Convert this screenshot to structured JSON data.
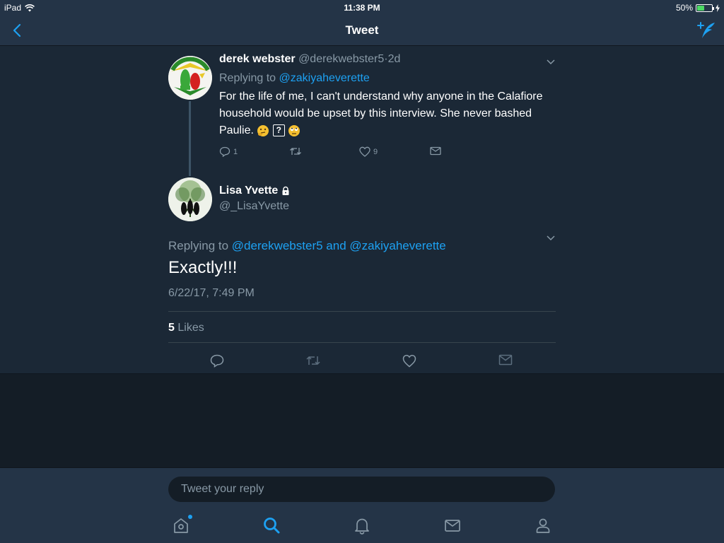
{
  "status_bar": {
    "device": "iPad",
    "time": "11:38 PM",
    "battery_percent": "50%",
    "battery_level": 0.5
  },
  "nav": {
    "title": "Tweet"
  },
  "reply_tweet": {
    "name": "derek webster",
    "handle": "@derekwebster5",
    "separator": "·",
    "age": "2d",
    "replying_prefix": "Replying to",
    "replying_to": "@zakiyaheverette",
    "text": "For the life of me, I can't understand why anyone in the Calafiore household would be upset by this interview. She never bashed Paulie.",
    "emoji_box": "?",
    "reply_count": "1",
    "like_count": "9"
  },
  "main_tweet": {
    "name": "Lisa Yvette",
    "handle": "@_LisaYvette",
    "replying_prefix": "Replying to",
    "replying_to_1": "@derekwebster5",
    "replying_and": "and",
    "replying_to_2": "@zakiyaheverette",
    "text": "Exactly!!!",
    "date": "6/22/17, 7:49 PM",
    "likes_count": "5",
    "likes_label": "Likes"
  },
  "composer": {
    "placeholder": "Tweet your reply"
  },
  "tabs": [
    "home",
    "search",
    "notifications",
    "messages",
    "profile"
  ],
  "colors": {
    "background": "#141d26",
    "surface": "#1b2836",
    "bar": "#243447",
    "accent": "#1da1f2",
    "muted": "#8899a6"
  }
}
